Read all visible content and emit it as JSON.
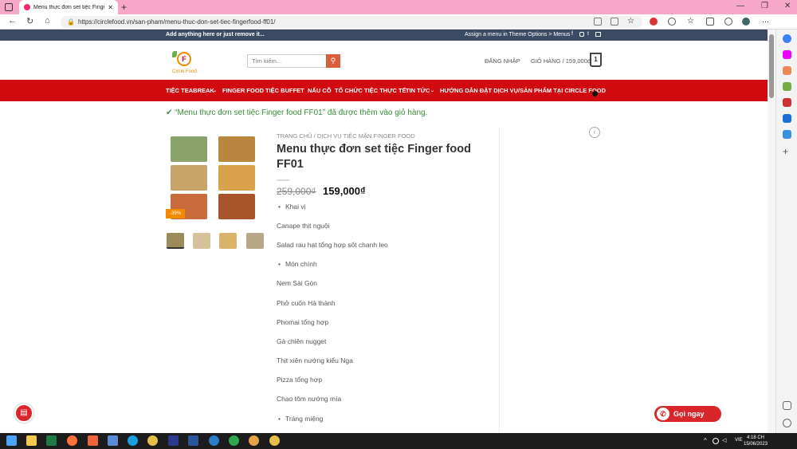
{
  "browser": {
    "tab_title": "Menu thực đơn set tiệc Finger fo",
    "url": "https://circlefood.vn/san-pham/menu-thuc-don-set-tiec-fingerfood-ff01/"
  },
  "topbar": {
    "left_text": "Add anything here or just remove it...",
    "right_text": "Assign a menu in Theme Options > Menus"
  },
  "header": {
    "logo_text": "Circle Food",
    "search_placeholder": "Tìm kiếm...",
    "login": "ĐĂNG NHẬP",
    "cart_label": "GIỎ HÀNG / 159,000đ",
    "cart_count": "1"
  },
  "menu": {
    "items": [
      "TIỆC TEABREAK",
      "FINGER FOOD",
      "TIỆC BUFFET",
      "NẤU CỖ",
      "TỔ CHỨC TIỆC THỰC TẾ",
      "TIN TỨC",
      "HƯỚNG DẪN ĐẶT DỊCH VỤ/SẢN PHẨM TẠI CIRCLE FOOD"
    ]
  },
  "notice": "✔ “Menu thực đơn set tiệc Finger food FF01” đã được thêm vào giỏ hàng.",
  "product": {
    "breadcrumb": "TRANG CHỦ  /  DỊCH VỤ TIỆC MẶN FINGER FOOD",
    "title": "Menu thực đơn set tiệc Finger food FF01",
    "old_price": "259,000₫",
    "new_price": "159,000₫",
    "sale_badge": "-39%",
    "lines": [
      {
        "type": "bullet",
        "text": "Khai vị"
      },
      {
        "type": "text",
        "text": "Canape thịt nguội"
      },
      {
        "type": "text",
        "text": "Salad rau hạt tổng hợp sốt chanh leo"
      },
      {
        "type": "bullet",
        "text": "Món chính"
      },
      {
        "type": "text",
        "text": "Nem Sài Gòn"
      },
      {
        "type": "text",
        "text": "Phở cuốn Hà thành"
      },
      {
        "type": "text",
        "text": "Phomai tổng hợp"
      },
      {
        "type": "text",
        "text": "Gà chiên nugget"
      },
      {
        "type": "text",
        "text": "Thịt xiên nướng kiểu Nga"
      },
      {
        "type": "text",
        "text": "Pizza tổng hợp"
      },
      {
        "type": "text",
        "text": "Chạo tôm nướng mía"
      },
      {
        "type": "bullet",
        "text": "Tráng miệng"
      }
    ]
  },
  "call_button": "Gọi ngay",
  "taskbar": {
    "time": "4:18 CH",
    "date": "15/06/2023",
    "lang": "VIE"
  },
  "colors": {
    "menu_red": "#d10a10",
    "topbar_navy": "#3c4b64",
    "notice_green": "#3a8a3a"
  }
}
